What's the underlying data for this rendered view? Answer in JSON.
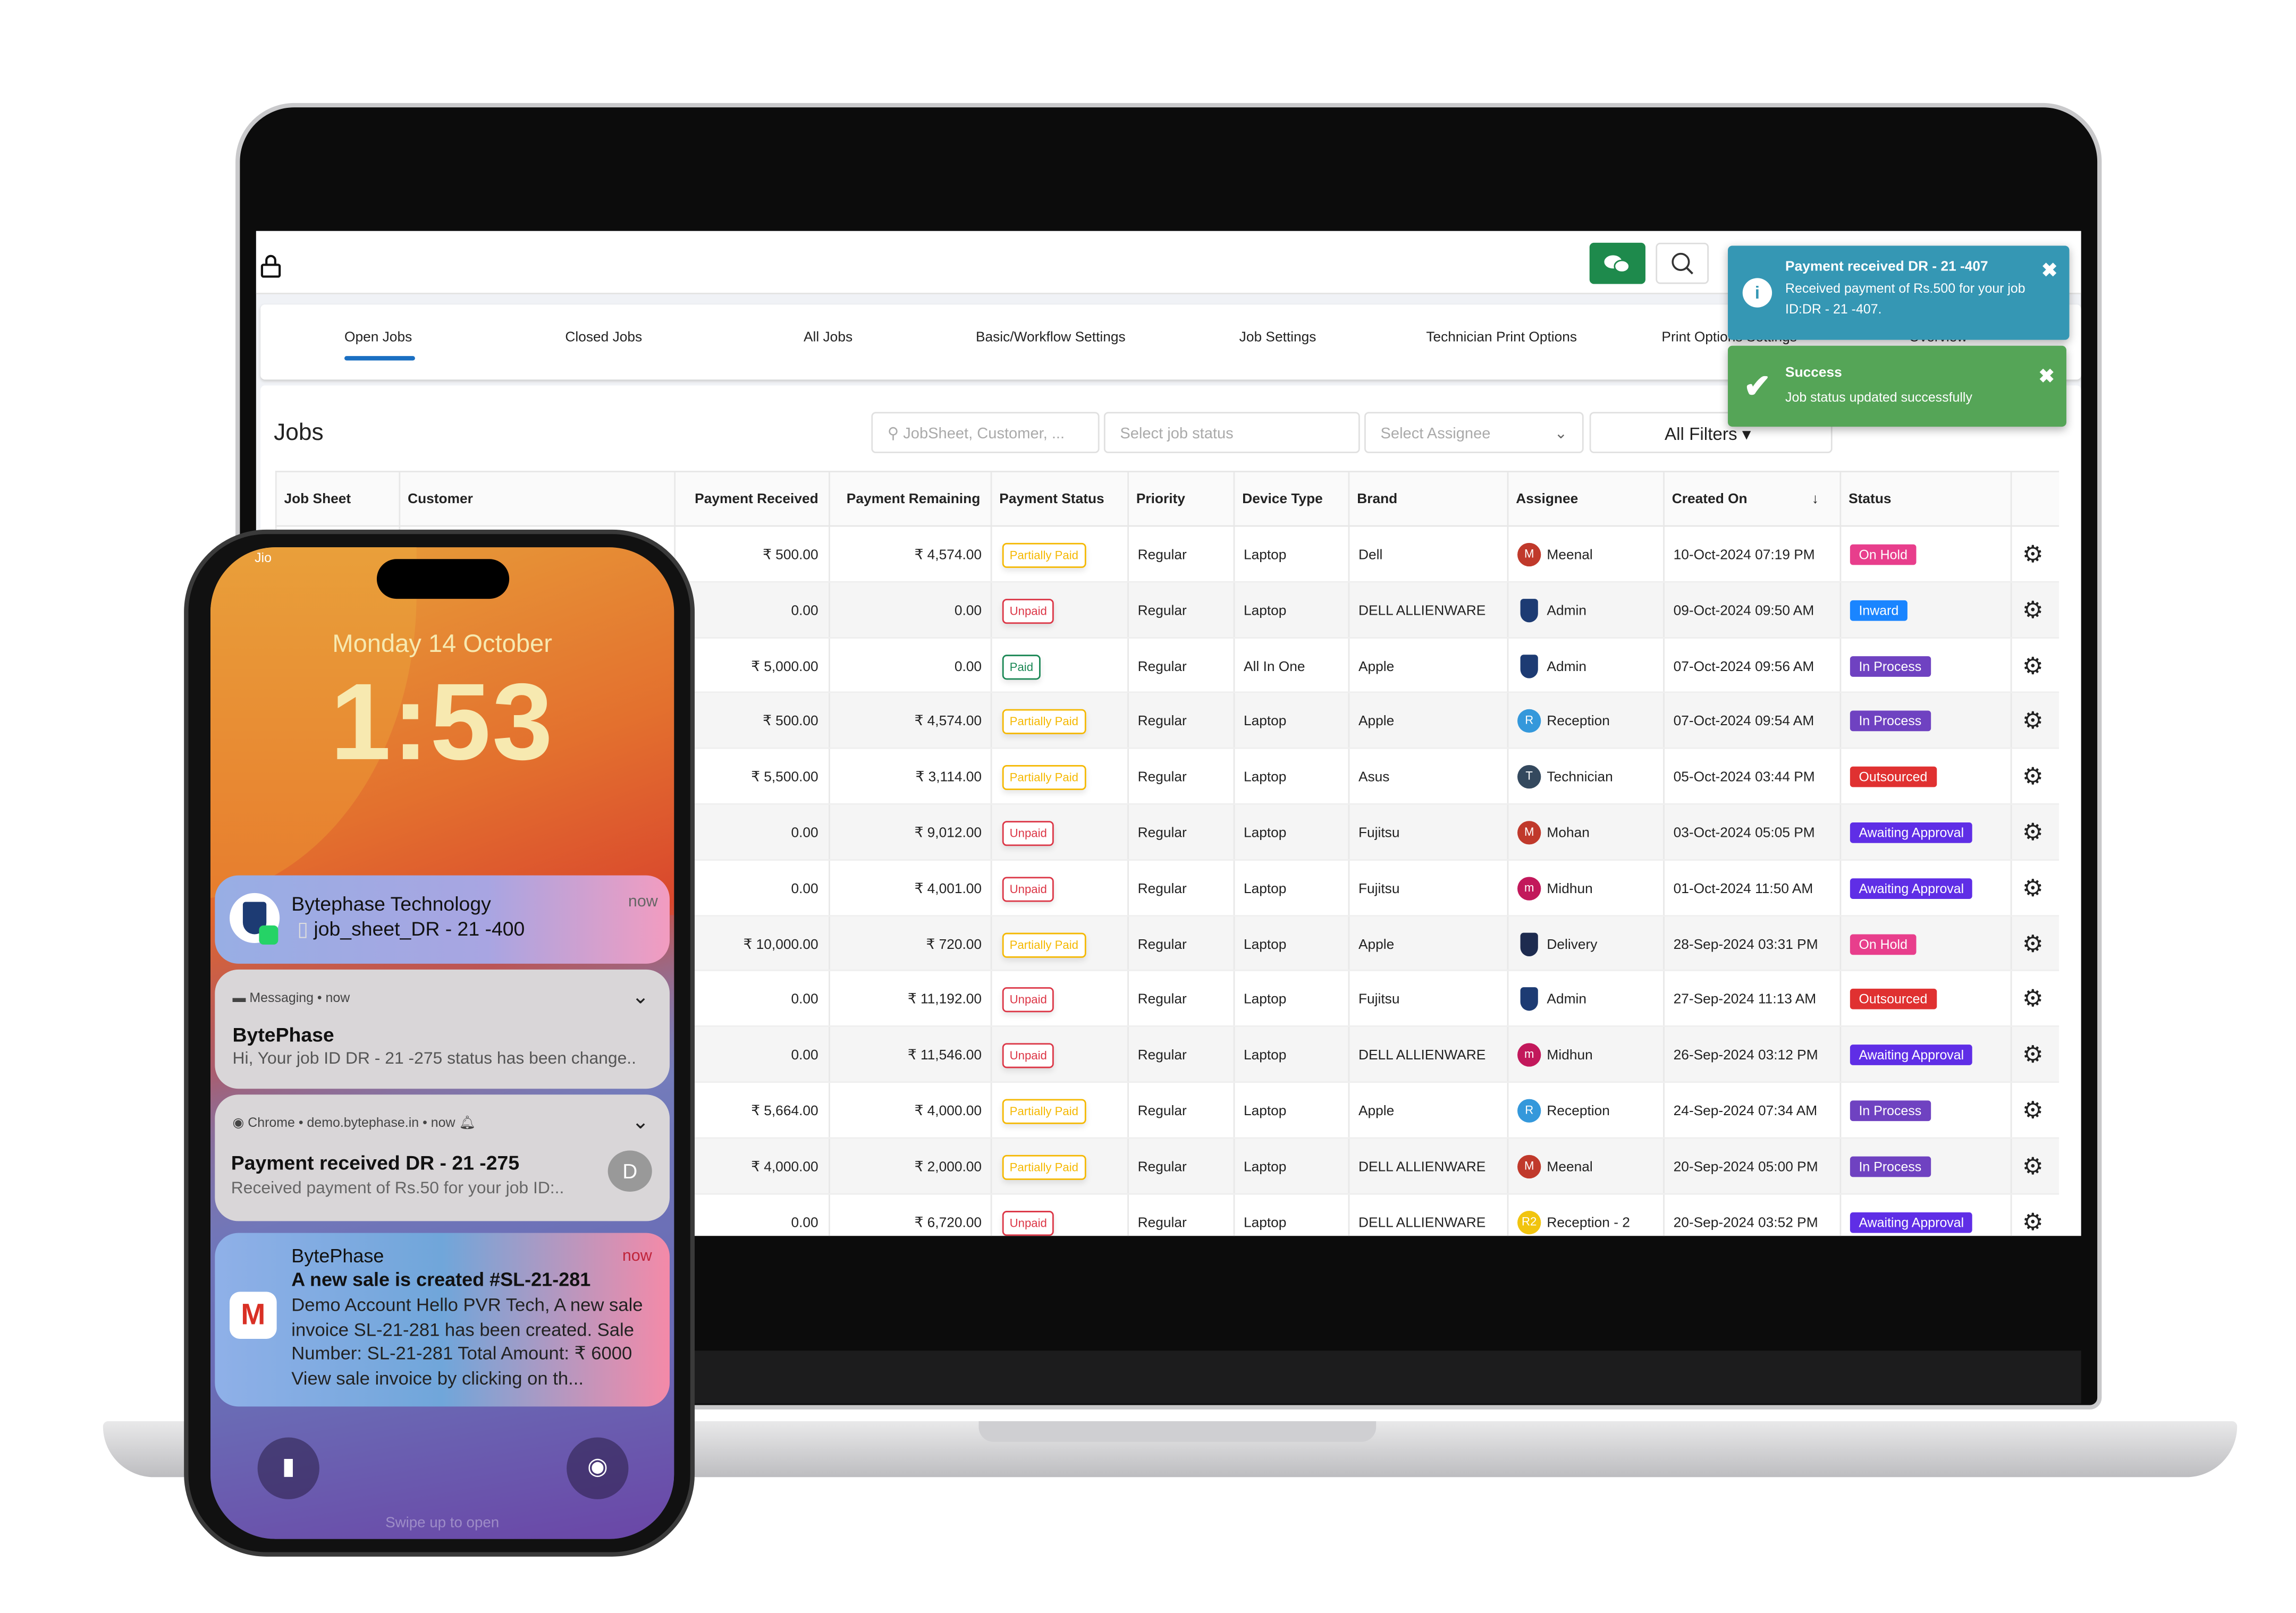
{
  "app": {
    "tabs": [
      "Open Jobs",
      "Closed Jobs",
      "All Jobs",
      "Basic/Workflow Settings",
      "Job Settings",
      "Technician Print Options",
      "Print Options Settings",
      "Overview"
    ],
    "active_tab": "Open Jobs",
    "page_title": "Jobs",
    "search_placeholder": "JobSheet, Customer, ...",
    "status_placeholder": "Select job status",
    "assignee_placeholder": "Select Assignee",
    "filters_label": "All Filters",
    "accent": "#1a6fc2",
    "columns": [
      "Job Sheet",
      "Customer",
      "Payment Received",
      "Payment Remaining",
      "Payment Status",
      "Priority",
      "Device Type",
      "Brand",
      "Assignee",
      "Created On",
      "Status"
    ],
    "rows": [
      {
        "received": "₹ 500.00",
        "remaining": "₹ 4,574.00",
        "pay": "Partially Paid",
        "priority": "Regular",
        "device": "Laptop",
        "brand": "Dell",
        "assignee": "Meenal",
        "avatar": "M",
        "avcolor": "#c0392b",
        "created": "10-Oct-2024 07:19 PM",
        "status": "On Hold"
      },
      {
        "received": "0.00",
        "remaining": "0.00",
        "pay": "Unpaid",
        "priority": "Regular",
        "device": "Laptop",
        "brand": "DELL ALLIENWARE",
        "assignee": "Admin",
        "avatar": "logo",
        "avcolor": "#1d3b73",
        "created": "09-Oct-2024 09:50 AM",
        "status": "Inward"
      },
      {
        "received": "₹ 5,000.00",
        "remaining": "0.00",
        "pay": "Paid",
        "priority": "Regular",
        "device": "All In One",
        "brand": "Apple",
        "assignee": "Admin",
        "avatar": "logo",
        "avcolor": "#1d3b73",
        "created": "07-Oct-2024 09:56 AM",
        "status": "In Process"
      },
      {
        "received": "₹ 500.00",
        "remaining": "₹ 4,574.00",
        "pay": "Partially Paid",
        "priority": "Regular",
        "device": "Laptop",
        "brand": "Apple",
        "assignee": "Reception",
        "avatar": "R",
        "avcolor": "#3498db",
        "created": "07-Oct-2024 09:54 AM",
        "status": "In Process"
      },
      {
        "received": "₹ 5,500.00",
        "remaining": "₹ 3,114.00",
        "pay": "Partially Paid",
        "priority": "Regular",
        "device": "Laptop",
        "brand": "Asus",
        "assignee": "Technician",
        "avatar": "T",
        "avcolor": "#34495e",
        "created": "05-Oct-2024 03:44 PM",
        "status": "Outsourced"
      },
      {
        "received": "0.00",
        "remaining": "₹ 9,012.00",
        "pay": "Unpaid",
        "priority": "Regular",
        "device": "Laptop",
        "brand": "Fujitsu",
        "assignee": "Mohan",
        "avatar": "M",
        "avcolor": "#c0392b",
        "created": "03-Oct-2024 05:05 PM",
        "status": "Awaiting Approval"
      },
      {
        "received": "0.00",
        "remaining": "₹ 4,001.00",
        "pay": "Unpaid",
        "priority": "Regular",
        "device": "Laptop",
        "brand": "Fujitsu",
        "assignee": "Midhun",
        "avatar": "m",
        "avcolor": "#c2185b",
        "created": "01-Oct-2024 11:50 AM",
        "status": "Awaiting Approval"
      },
      {
        "received": "₹ 10,000.00",
        "remaining": "₹ 720.00",
        "pay": "Partially Paid",
        "priority": "Regular",
        "device": "Laptop",
        "brand": "Apple",
        "assignee": "Delivery",
        "avatar": "logo",
        "avcolor": "#1d2b4f",
        "created": "28-Sep-2024 03:31 PM",
        "status": "On Hold"
      },
      {
        "received": "0.00",
        "remaining": "₹ 11,192.00",
        "pay": "Unpaid",
        "priority": "Regular",
        "device": "Laptop",
        "brand": "Fujitsu",
        "assignee": "Admin",
        "avatar": "logo",
        "avcolor": "#1d3b73",
        "created": "27-Sep-2024 11:13 AM",
        "status": "Outsourced"
      },
      {
        "received": "0.00",
        "remaining": "₹ 11,546.00",
        "pay": "Unpaid",
        "priority": "Regular",
        "device": "Laptop",
        "brand": "DELL ALLIENWARE",
        "assignee": "Midhun",
        "avatar": "m",
        "avcolor": "#c2185b",
        "created": "26-Sep-2024 03:12 PM",
        "status": "Awaiting Approval"
      },
      {
        "received": "₹ 5,664.00",
        "remaining": "₹ 4,000.00",
        "pay": "Partially Paid",
        "priority": "Regular",
        "device": "Laptop",
        "brand": "Apple",
        "assignee": "Reception",
        "avatar": "R",
        "avcolor": "#3498db",
        "created": "24-Sep-2024 07:34 AM",
        "status": "In Process"
      },
      {
        "received": "₹ 4,000.00",
        "remaining": "₹ 2,000.00",
        "pay": "Partially Paid",
        "priority": "Regular",
        "device": "Laptop",
        "brand": "DELL ALLIENWARE",
        "assignee": "Meenal",
        "avatar": "M",
        "avcolor": "#c0392b",
        "created": "20-Sep-2024 05:00 PM",
        "status": "In Process"
      },
      {
        "received": "0.00",
        "remaining": "₹ 6,720.00",
        "pay": "Unpaid",
        "priority": "Regular",
        "device": "Laptop",
        "brand": "DELL ALLIENWARE",
        "assignee": "Reception - 2",
        "avatar": "R2",
        "avcolor": "#f1c40f",
        "created": "20-Sep-2024 03:52 PM",
        "status": "Awaiting Approval"
      }
    ],
    "pay_colors": {
      "Partially Paid": "#f5b800",
      "Unpaid": "#dc3545",
      "Paid": "#198754"
    },
    "status_colors": {
      "On Hold": "#e83e8c",
      "Inward": "#1a85ff",
      "In Process": "#6f42c1",
      "Outsourced": "#e03131",
      "Awaiting Approval": "#5f2ee6"
    },
    "toasts": [
      {
        "title": "Payment received DR - 21 -407",
        "body": "Received payment of Rs.500 for your job ID:DR - 21 -407.",
        "color": "#3597b4",
        "icon": "info-icon"
      },
      {
        "title": "Success",
        "body": "Job status updated successfully",
        "color": "#55a557",
        "icon": "check-icon"
      }
    ]
  },
  "phone": {
    "carrier": "Jio",
    "date": "Monday 14 October",
    "time": "1:53",
    "swipe": "Swipe up to open",
    "notifications": [
      {
        "title": "Bytephase Technology",
        "body": "job_sheet_DR - 21 -400",
        "time": "now"
      },
      {
        "app": "Messaging",
        "time": "now",
        "title": "BytePhase",
        "body": "Hi, Your job ID DR - 21 -275 status has been change.."
      },
      {
        "app": "Chrome",
        "site": "demo.bytephase.in",
        "time": "now",
        "title": "Payment received DR - 21 -275",
        "body": "Received payment of Rs.50 for your job ID:..",
        "avatar": "D"
      },
      {
        "title": "BytePhase",
        "subtitle": "A new sale is created #SL-21-281",
        "body": "Demo Account Hello PVR Tech, A new sale invoice SL-21-281 has been created. Sale Number: SL-21-281 Total Amount: ₹ 6000 View sale invoice by clicking on th...",
        "time": "now"
      }
    ]
  }
}
